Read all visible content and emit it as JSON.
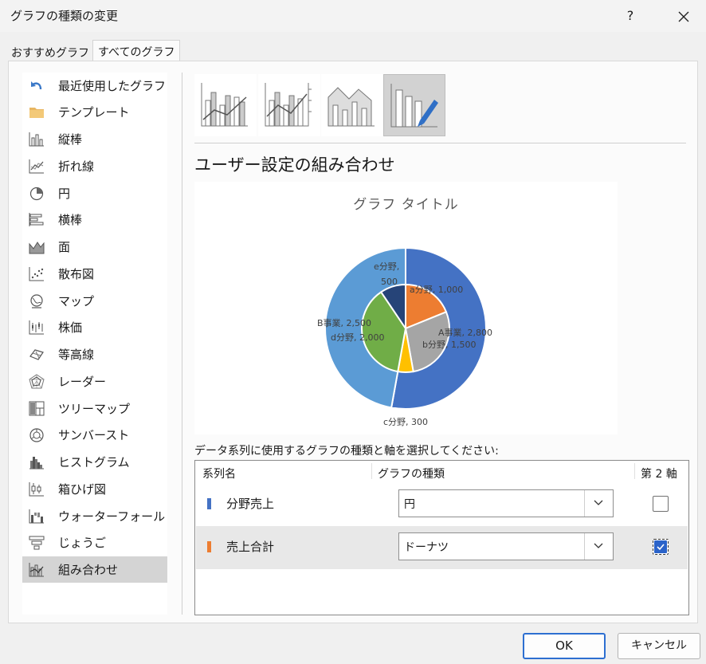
{
  "window": {
    "title": "グラフの種類の変更",
    "help_label": "?"
  },
  "tabs": [
    {
      "label": "おすすめグラフ"
    },
    {
      "label": "すべてのグラフ"
    }
  ],
  "categories": [
    {
      "label": "最近使用したグラフ",
      "icon": "undo-icon"
    },
    {
      "label": "テンプレート",
      "icon": "folder-icon"
    },
    {
      "label": "縦棒",
      "icon": "column-chart-icon"
    },
    {
      "label": "折れ線",
      "icon": "line-chart-icon"
    },
    {
      "label": "円",
      "icon": "pie-chart-icon"
    },
    {
      "label": "横棒",
      "icon": "bar-chart-icon"
    },
    {
      "label": "面",
      "icon": "area-chart-icon"
    },
    {
      "label": "散布図",
      "icon": "scatter-chart-icon"
    },
    {
      "label": "マップ",
      "icon": "map-chart-icon"
    },
    {
      "label": "株価",
      "icon": "stock-chart-icon"
    },
    {
      "label": "等高線",
      "icon": "surface-chart-icon"
    },
    {
      "label": "レーダー",
      "icon": "radar-chart-icon"
    },
    {
      "label": "ツリーマップ",
      "icon": "treemap-icon"
    },
    {
      "label": "サンバースト",
      "icon": "sunburst-icon"
    },
    {
      "label": "ヒストグラム",
      "icon": "histogram-icon"
    },
    {
      "label": "箱ひげ図",
      "icon": "box-whisker-icon"
    },
    {
      "label": "ウォーターフォール",
      "icon": "waterfall-icon"
    },
    {
      "label": "じょうご",
      "icon": "funnel-icon"
    },
    {
      "label": "組み合わせ",
      "icon": "combo-chart-icon"
    }
  ],
  "selected_category": "組み合わせ",
  "subtypes": [
    {
      "name": "clustered-column-line",
      "icon": "clustered-column-line-icon"
    },
    {
      "name": "clustered-column-line-secondary",
      "icon": "clustered-column-line-secondary-icon"
    },
    {
      "name": "stacked-area-clustered-column",
      "icon": "stacked-area-column-icon"
    },
    {
      "name": "custom-combination",
      "icon": "custom-combo-icon",
      "selected": true
    }
  ],
  "section_title": "ユーザー設定の組み合わせ",
  "chart_preview": {
    "title": "グラフ タイトル",
    "labels": [
      "e分野,",
      "500",
      "a分野, 1,000",
      "A事業, 2,800",
      "b分野, 1,500",
      "B事業, 2,500",
      "d分野, 2,000",
      "c分野, 300"
    ]
  },
  "chart_data": {
    "type": "pie",
    "title": "グラフ タイトル",
    "series": [
      {
        "name": "分野売上",
        "chart_type": "円",
        "categories": [
          "A事業",
          "B事業"
        ],
        "values": [
          2800,
          2500
        ],
        "colors": [
          "#4472c4",
          "#5b9bd5"
        ]
      },
      {
        "name": "売上合計",
        "chart_type": "ドーナツ",
        "secondary_axis": true,
        "categories": [
          "a分野",
          "b分野",
          "c分野",
          "d分野",
          "e分野"
        ],
        "values": [
          1000,
          1500,
          300,
          2000,
          500
        ],
        "colors": [
          "#ed7d31",
          "#a5a5a5",
          "#ffc000",
          "#70ad47",
          "#264478"
        ]
      }
    ]
  },
  "instruction": "データ系列に使用するグラフの種類と軸を選択してください:",
  "series_table": {
    "headers": {
      "name": "系列名",
      "type": "グラフの種類",
      "secondary": "第 2 軸"
    },
    "rows": [
      {
        "name": "分野売上",
        "type": "円",
        "secondary": false,
        "color": "#4472c4"
      },
      {
        "name": "売上合計",
        "type": "ドーナツ",
        "secondary": true,
        "color": "#ed7d31"
      }
    ]
  },
  "buttons": {
    "ok": "OK",
    "cancel": "キャンセル"
  }
}
